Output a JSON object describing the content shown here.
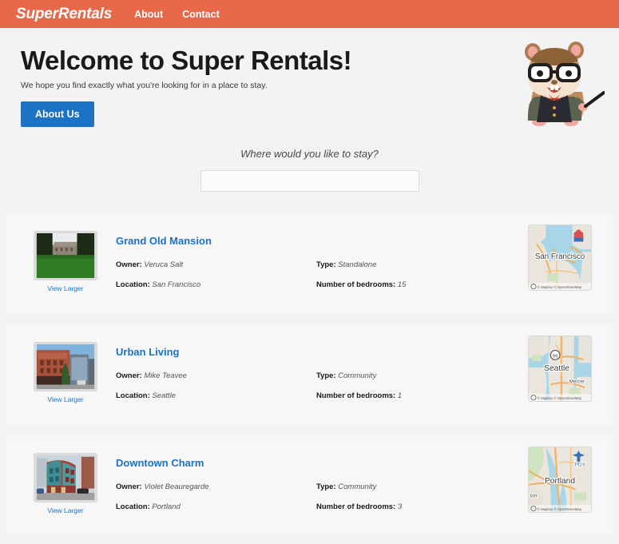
{
  "header": {
    "brand": "SuperRentals",
    "nav": [
      {
        "label": "About",
        "name": "nav-link-about"
      },
      {
        "label": "Contact",
        "name": "nav-link-contact"
      }
    ],
    "brand_bg": "#e8684a"
  },
  "hero": {
    "title": "Welcome to Super Rentals!",
    "subtitle": "We hope you find exactly what you're looking for in a place to stay.",
    "button_label": "About Us",
    "button_color": "#1c72c4",
    "mascot_alt": "tomster-mascot"
  },
  "search": {
    "label": "Where would you like to stay?",
    "value": "",
    "placeholder": ""
  },
  "labels": {
    "owner": "Owner:",
    "location": "Location:",
    "type": "Type:",
    "bedrooms": "Number of bedrooms:",
    "view_larger": "View Larger"
  },
  "map_attribution": "© Mapbox © OpenStreetMap",
  "listings": [
    {
      "title": "Grand Old Mansion",
      "owner": "Veruca Salt",
      "location": "San Francisco",
      "type": "Standalone",
      "bedrooms": "15",
      "map_label": "San Francisco",
      "map_secondary": ""
    },
    {
      "title": "Urban Living",
      "owner": "Mike Teavee",
      "location": "Seattle",
      "type": "Community",
      "bedrooms": "1",
      "map_label": "Seattle",
      "map_secondary": "Mercer"
    },
    {
      "title": "Downtown Charm",
      "owner": "Violet Beauregarde",
      "location": "Portland",
      "type": "Community",
      "bedrooms": "3",
      "map_label": "Portland",
      "map_secondary": "PDX"
    }
  ]
}
